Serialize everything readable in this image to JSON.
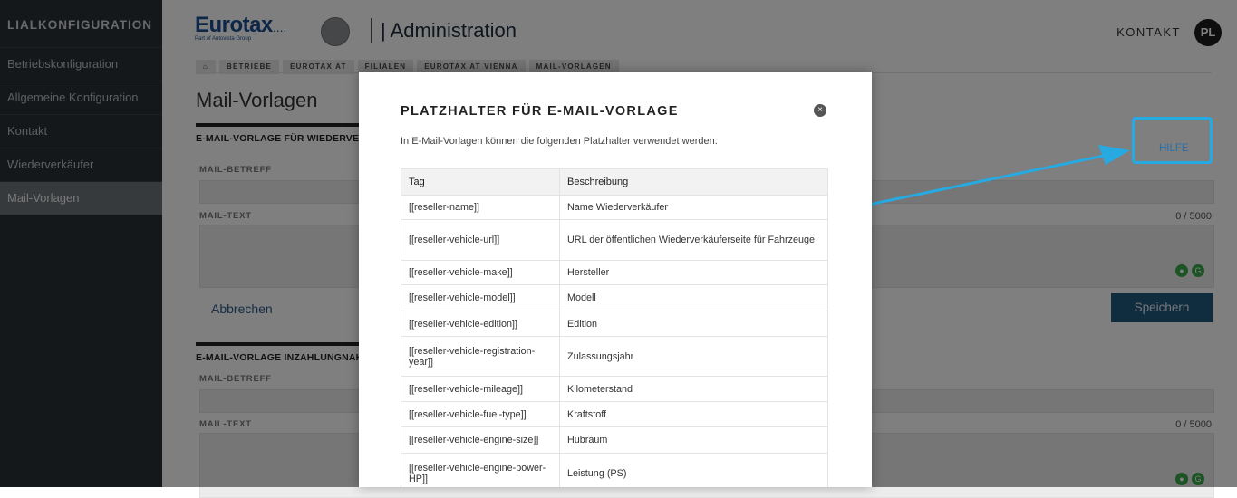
{
  "sidebar": {
    "title": "LIALKONFIGURATION",
    "items": [
      {
        "label": "Betriebskonfiguration"
      },
      {
        "label": "Allgemeine Konfiguration"
      },
      {
        "label": "Kontakt"
      },
      {
        "label": "Wiederverkäufer"
      },
      {
        "label": "Mail-Vorlagen",
        "active": true
      }
    ]
  },
  "header": {
    "logo": "Eurotax",
    "logo_dots": "....",
    "logo_sub": "Part of Autovista Group",
    "title": "| Administration",
    "kontakt": "KONTAKT",
    "avatar": "PL"
  },
  "breadcrumb": [
    "BETRIEBE",
    "EUROTAX AT",
    "FILIALEN",
    "EUROTAX AT VIENNA",
    "MAIL-VORLAGEN"
  ],
  "main": {
    "page_title": "Mail-Vorlagen",
    "section1": "E-MAIL-VORLAGE FÜR WIEDERVERKÄUFER",
    "section2": "E-MAIL-VORLAGE INZAHLUNGNAHME",
    "mail_betreff": "MAIL-BETREFF",
    "mail_text": "MAIL-TEXT",
    "counter": "0 / 5000",
    "hilfe": "HILFE",
    "abbrechen": "Abbrechen",
    "speichern": "Speichern"
  },
  "modal": {
    "title": "PLATZHALTER FÜR E-MAIL-VORLAGE",
    "close": "×",
    "intro": "In E-Mail-Vorlagen können die folgenden Platzhalter verwendet werden:",
    "headers": [
      "Tag",
      "Beschreibung"
    ],
    "rows": [
      {
        "tag": "[[reseller-name]]",
        "desc": "Name Wiederverkäufer"
      },
      {
        "tag": "[[reseller-vehicle-url]]",
        "desc": "URL der öffentlichen Wiederverkäuferseite für Fahrzeuge"
      },
      {
        "tag": "[[reseller-vehicle-make]]",
        "desc": "Hersteller"
      },
      {
        "tag": "[[reseller-vehicle-model]]",
        "desc": "Modell"
      },
      {
        "tag": "[[reseller-vehicle-edition]]",
        "desc": "Edition"
      },
      {
        "tag": "[[reseller-vehicle-registration-year]]",
        "desc": "Zulassungsjahr"
      },
      {
        "tag": "[[reseller-vehicle-mileage]]",
        "desc": "Kilometerstand"
      },
      {
        "tag": "[[reseller-vehicle-fuel-type]]",
        "desc": "Kraftstoff"
      },
      {
        "tag": "[[reseller-vehicle-engine-size]]",
        "desc": "Hubraum"
      },
      {
        "tag": "[[reseller-vehicle-engine-power-HP]]",
        "desc": "Leistung (PS)"
      }
    ]
  },
  "colors": {
    "sidebar_bg": "#2b3036",
    "brand_blue": "#1d4f91",
    "save_button": "#215a7f",
    "annotation_blue": "#27a9e1"
  }
}
